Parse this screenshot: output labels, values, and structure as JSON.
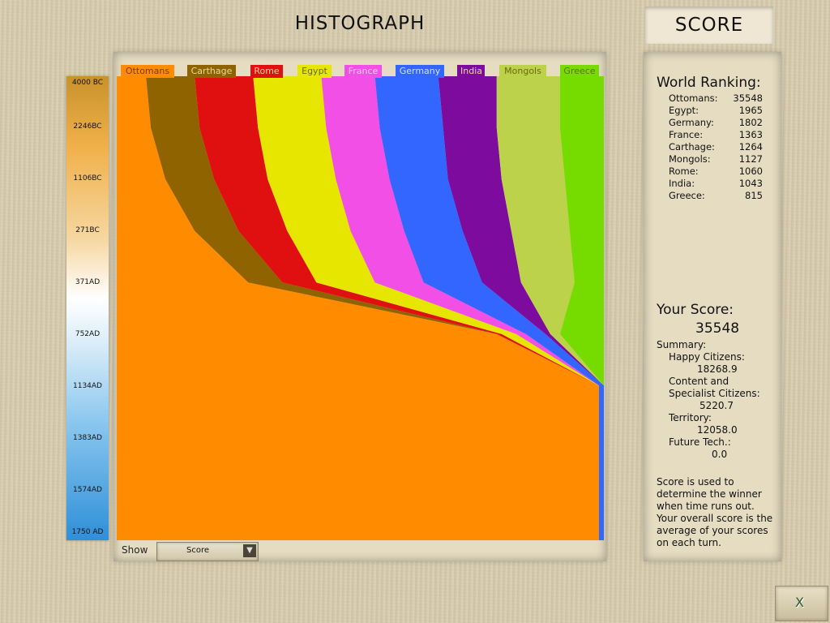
{
  "header": {
    "title": "HISTOGRAPH",
    "score_tab": "SCORE"
  },
  "chart_data": {
    "type": "area",
    "stacked": true,
    "normalized": true,
    "orientation": "vertical-time",
    "y_tick_labels": [
      "4000 BC",
      "2246BC",
      "1106BC",
      "271BC",
      "371AD",
      "752AD",
      "1134AD",
      "1383AD",
      "1574AD",
      "1750 AD"
    ],
    "series": [
      {
        "name": "Ottomans",
        "color": "#ff8c00",
        "share_per_tick": [
          0.06,
          0.07,
          0.1,
          0.16,
          0.27,
          0.78,
          0.99,
          0.99,
          0.99,
          0.99
        ]
      },
      {
        "name": "Carthage",
        "color": "#8e6300",
        "share_per_tick": [
          0.1,
          0.1,
          0.1,
          0.09,
          0.07,
          0.0,
          0.0,
          0.0,
          0.0,
          0.0
        ]
      },
      {
        "name": "Rome",
        "color": "#e01010",
        "share_per_tick": [
          0.12,
          0.12,
          0.11,
          0.1,
          0.07,
          0.01,
          0.0,
          0.0,
          0.0,
          0.0
        ]
      },
      {
        "name": "Egypt",
        "color": "#e6e600",
        "share_per_tick": [
          0.14,
          0.14,
          0.14,
          0.13,
          0.12,
          0.03,
          0.0,
          0.0,
          0.0,
          0.0
        ]
      },
      {
        "name": "France",
        "color": "#f24fe6",
        "share_per_tick": [
          0.11,
          0.11,
          0.11,
          0.11,
          0.1,
          0.02,
          0.0,
          0.0,
          0.0,
          0.0
        ]
      },
      {
        "name": "Germany",
        "color": "#3366ff",
        "share_per_tick": [
          0.13,
          0.13,
          0.12,
          0.12,
          0.12,
          0.04,
          0.01,
          0.01,
          0.01,
          0.01
        ]
      },
      {
        "name": "India",
        "color": "#7c0b9e",
        "share_per_tick": [
          0.12,
          0.11,
          0.11,
          0.1,
          0.08,
          0.01,
          0.0,
          0.0,
          0.0,
          0.0
        ]
      },
      {
        "name": "Mongols",
        "color": "#bcd24a",
        "share_per_tick": [
          0.13,
          0.13,
          0.13,
          0.12,
          0.11,
          0.02,
          0.0,
          0.0,
          0.0,
          0.0
        ]
      },
      {
        "name": "Greece",
        "color": "#76dc00",
        "share_per_tick": [
          0.09,
          0.09,
          0.08,
          0.07,
          0.06,
          0.09,
          0.0,
          0.0,
          0.0,
          0.0
        ]
      }
    ]
  },
  "show": {
    "label": "Show",
    "selected": "Score"
  },
  "world_ranking": {
    "title": "World Ranking:",
    "rows": [
      {
        "name": "Ottomans:",
        "score": "35548"
      },
      {
        "name": "Egypt:",
        "score": "1965"
      },
      {
        "name": "Germany:",
        "score": "1802"
      },
      {
        "name": "France:",
        "score": "1363"
      },
      {
        "name": "Carthage:",
        "score": "1264"
      },
      {
        "name": "Mongols:",
        "score": "1127"
      },
      {
        "name": "Rome:",
        "score": "1060"
      },
      {
        "name": "India:",
        "score": "1043"
      },
      {
        "name": "Greece:",
        "score": "815"
      }
    ]
  },
  "your_score": {
    "title": "Your Score:",
    "value": "35548",
    "summary_label": "Summary:",
    "happy_label": "Happy Citizens:",
    "happy_value": "18268.9",
    "content_label_1": "Content and",
    "content_label_2": "Specialist Citizens:",
    "content_value": "5220.7",
    "territory_label": "Territory:",
    "territory_value": "12058.0",
    "future_label": "Future Tech.:",
    "future_value": "0.0"
  },
  "note": [
    "Score is used to",
    "determine the winner",
    "when time runs out.",
    "Your overall score is the",
    "average of your scores",
    "on each turn."
  ],
  "close_button": "X"
}
